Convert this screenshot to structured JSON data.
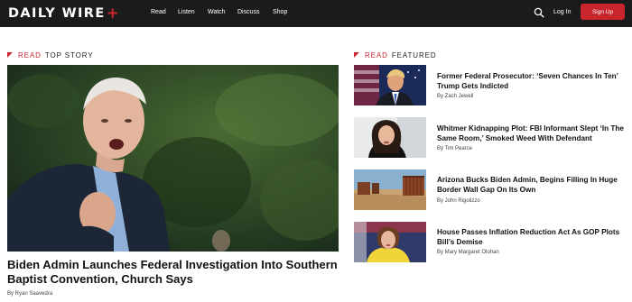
{
  "nav": {
    "logo_main": "DAILY WIRE",
    "logo_plus": "+",
    "links": [
      "Read",
      "Listen",
      "Watch",
      "Discuss",
      "Shop"
    ],
    "login": "Log In",
    "signup": "Sign Up",
    "icons": [
      "search-icon"
    ]
  },
  "top_story": {
    "label_read": "READ",
    "label_section": "TOP STORY",
    "headline": "Biden Admin Launches Federal Investigation Into Southern Baptist Convention, Church Says",
    "byline": "By Ryan Saavedra"
  },
  "featured": {
    "label_read": "READ",
    "label_section": "FEATURED",
    "items": [
      {
        "title": "Former Federal Prosecutor: ‘Seven Chances In Ten’ Trump Gets Indicted",
        "byline": "By Zach Jewell"
      },
      {
        "title": "Whitmer Kidnapping Plot: FBI Informant Slept ‘In The Same Room,’ Smoked Weed With Defendant",
        "byline": "By Tim Pearce"
      },
      {
        "title": "Arizona Bucks Biden Admin, Begins Filling In Huge Border Wall Gap On Its Own",
        "byline": "By John Rigolizzo"
      },
      {
        "title": "House Passes Inflation Reduction Act As GOP Plots Bill’s Demise",
        "byline": "By Mary Margaret Olohan"
      }
    ]
  },
  "colors": {
    "brand_red": "#c8262c",
    "nav_bg": "#1b1b1b"
  }
}
